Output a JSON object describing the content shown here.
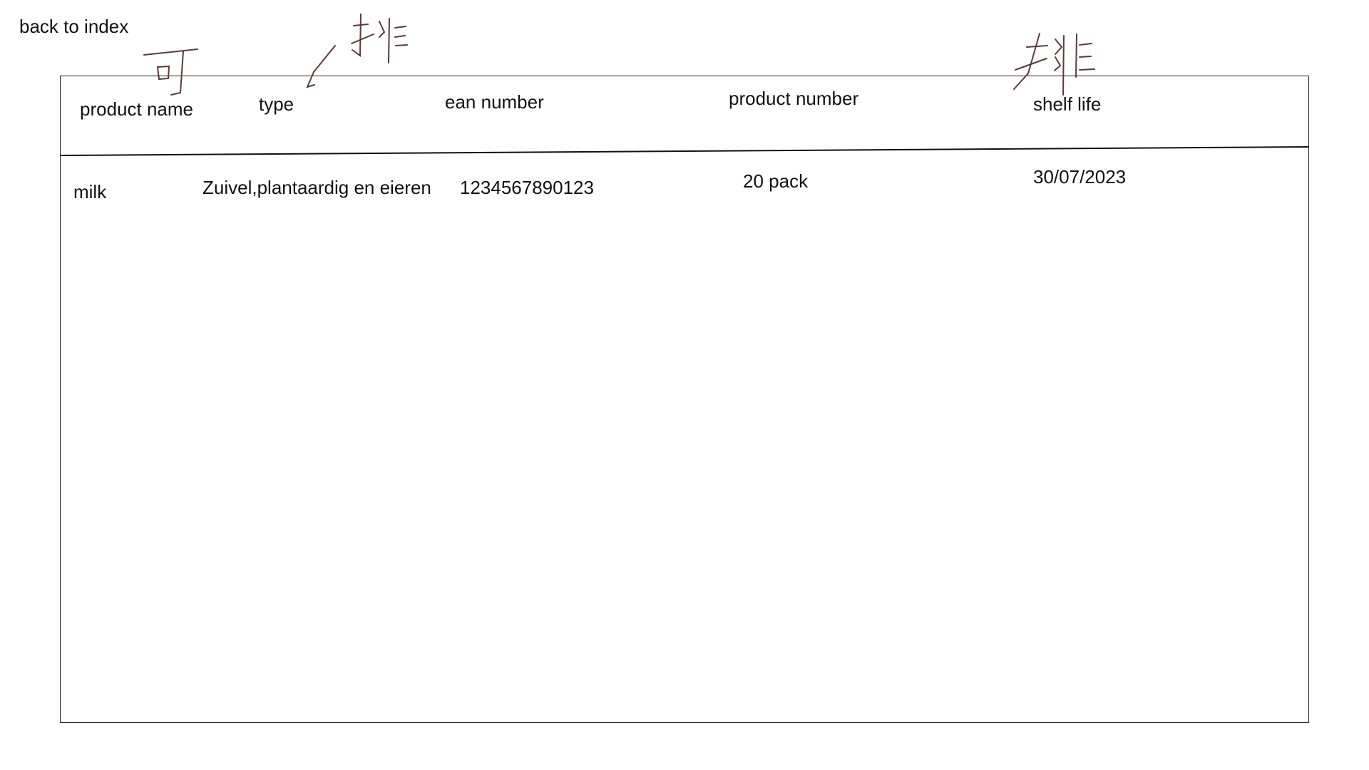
{
  "nav": {
    "back_label": "back to index"
  },
  "table": {
    "headers": [
      "product name",
      "type",
      "ean number",
      "product number",
      "shelf life"
    ],
    "rows": [
      [
        "milk",
        "Zuivel,plantaardig en eieren",
        "1234567890123",
        "20 pack",
        "30/07/2023"
      ]
    ]
  },
  "colors": {
    "ink": "#111111",
    "annotation_stroke": "#5a3a3a"
  },
  "icons": {
    "annotation_1": "handwritten-mark-icon",
    "annotation_2": "handwritten-sort-icon",
    "annotation_3": "handwritten-sort-icon"
  }
}
